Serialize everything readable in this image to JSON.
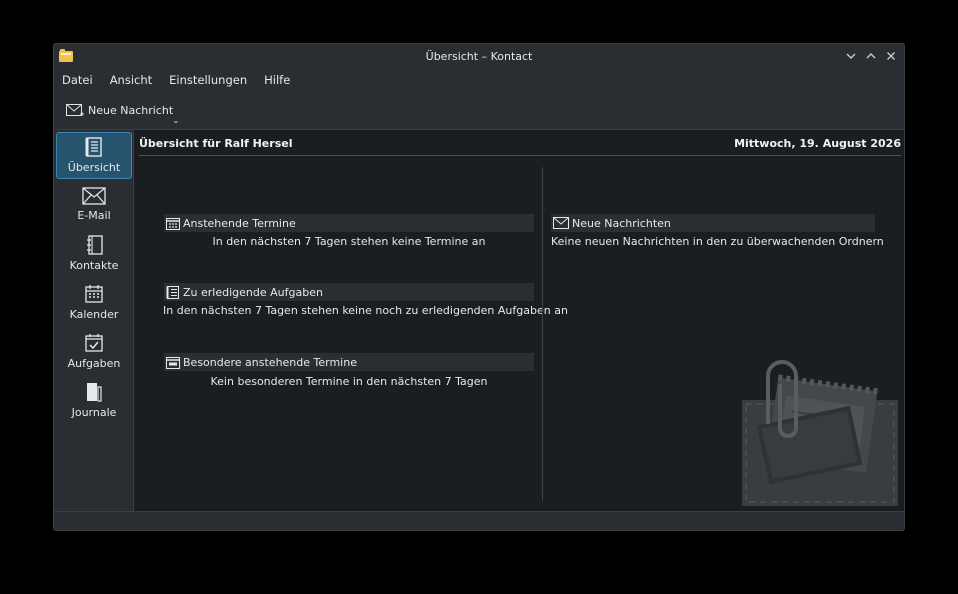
{
  "window": {
    "title": "Übersicht – Kontact"
  },
  "menubar": {
    "items": [
      "Datei",
      "Ansicht",
      "Einstellungen",
      "Hilfe"
    ]
  },
  "toolbar": {
    "new_message_label": "Neue Nachricht"
  },
  "sidebar": {
    "items": [
      {
        "label": "Übersicht",
        "icon": "overview-icon",
        "active": true
      },
      {
        "label": "E-Mail",
        "icon": "mail-icon"
      },
      {
        "label": "Kontakte",
        "icon": "contacts-icon"
      },
      {
        "label": "Kalender",
        "icon": "calendar-icon"
      },
      {
        "label": "Aufgaben",
        "icon": "tasks-icon"
      },
      {
        "label": "Journale",
        "icon": "journal-icon"
      }
    ]
  },
  "summary": {
    "title": "Übersicht für Ralf Hersel",
    "date": "Mittwoch, 19. August 2026",
    "sections": {
      "appointments": {
        "title": "Anstehende Termine",
        "text": "In den nächsten 7 Tagen stehen keine Termine an"
      },
      "todos": {
        "title": "Zu erledigende Aufgaben",
        "text": "In den nächsten 7 Tagen stehen keine noch zu erledigenden Aufgaben an"
      },
      "special": {
        "title": "Besondere anstehende Termine",
        "text": "Kein besonderen Termine in den nächsten 7 Tagen"
      },
      "mail": {
        "title": "Neue Nachrichten",
        "text": "Keine neuen Nachrichten in den zu überwachenden Ordnern"
      }
    }
  },
  "colors": {
    "accent": "#3d87b3",
    "active_bg": "#26536e",
    "window_bg": "#232629",
    "content_bg": "#1b1e20"
  }
}
